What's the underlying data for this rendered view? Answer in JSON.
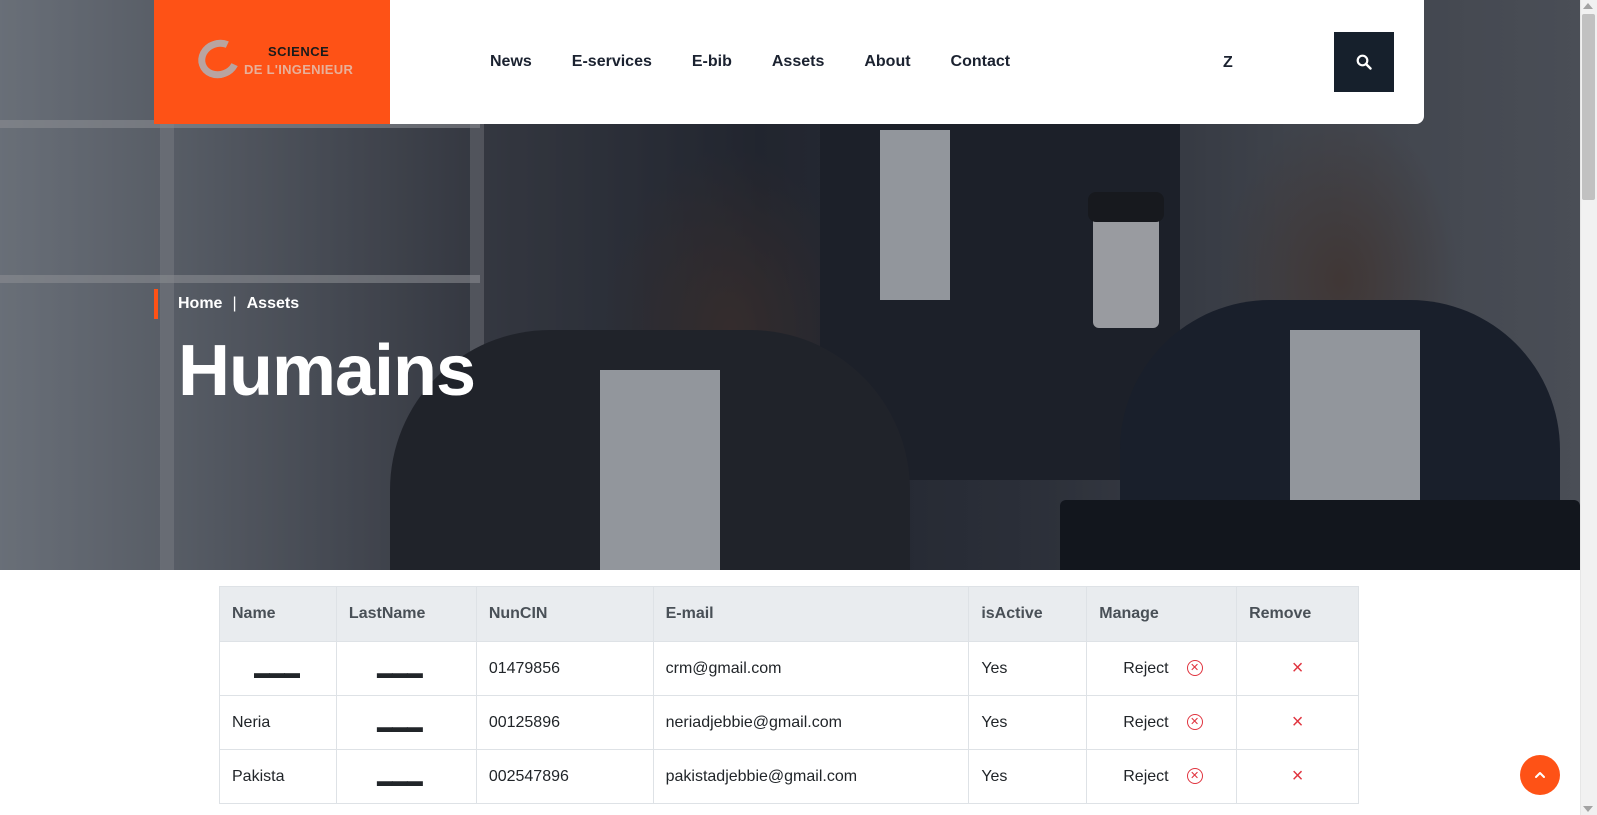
{
  "header": {
    "logo": {
      "line1": "SCIENCE",
      "line2": "DE L'INGENIEUR"
    },
    "nav": [
      "News",
      "E-services",
      "E-bib",
      "Assets",
      "About",
      "Contact"
    ],
    "language": "Z",
    "search_icon": "search-icon"
  },
  "breadcrumb": {
    "home": "Home",
    "separator": "|",
    "current": "Assets"
  },
  "page_title": "Humains",
  "table": {
    "headers": [
      "Name",
      "LastName",
      "NunCIN",
      "E-mail",
      "isActive",
      "Manage",
      "Remove"
    ],
    "rows": [
      {
        "name": "▬▬▬",
        "lastname": "▬▬▬",
        "cin": "01479856",
        "email": "crm@gmail.com",
        "active": "Yes",
        "manage": "Reject"
      },
      {
        "name": "Neria",
        "lastname": "▬▬▬",
        "cin": "00125896",
        "email": "neriadjebbie@gmail.com",
        "active": "Yes",
        "manage": "Reject"
      },
      {
        "name": "Pakista",
        "lastname": "▬▬▬",
        "cin": "002547896",
        "email": "pakistadjebbie@gmail.com",
        "active": "Yes",
        "manage": "Reject"
      }
    ]
  },
  "colors": {
    "accent": "#fe5216",
    "dark": "#16202c",
    "danger": "#e0343f"
  }
}
